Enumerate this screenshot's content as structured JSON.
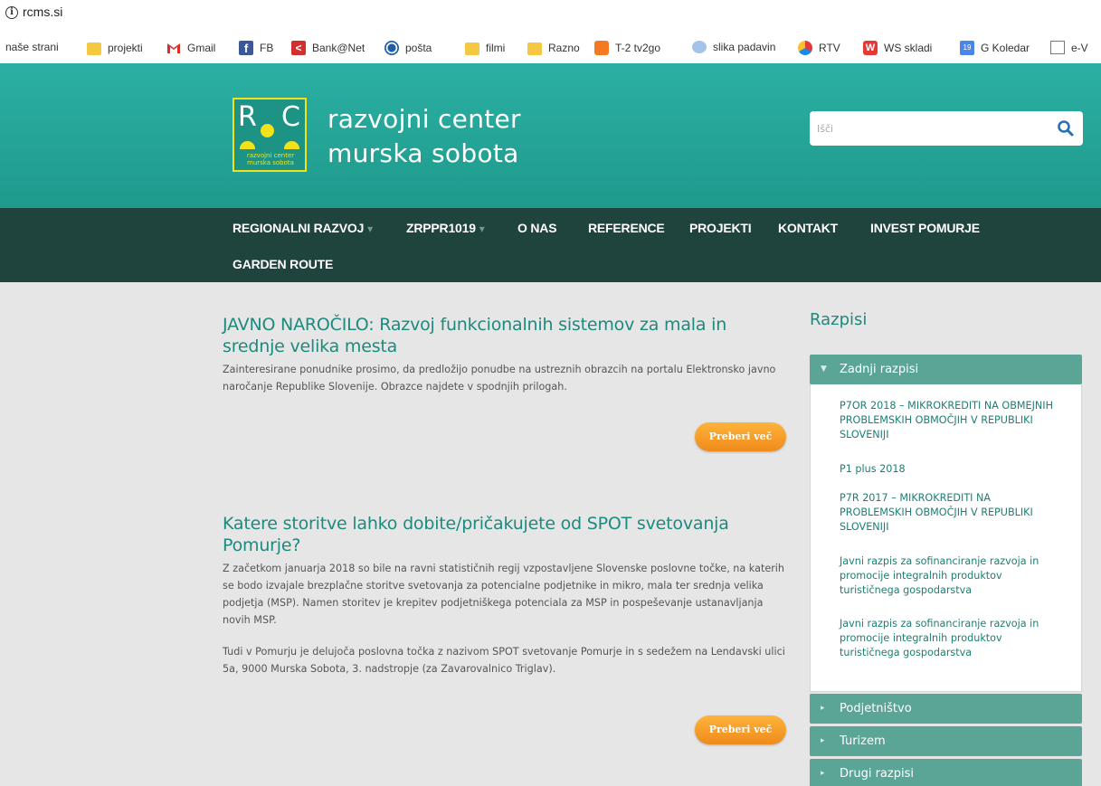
{
  "browser": {
    "url": "rcms.si",
    "bookmarks": [
      {
        "label": "naše strani",
        "icon": "none"
      },
      {
        "label": "projekti",
        "icon": "folder-icon"
      },
      {
        "label": "Gmail",
        "icon": "gmail-icon"
      },
      {
        "label": "FB",
        "icon": "facebook-icon"
      },
      {
        "label": "Bank@Net",
        "icon": "bank-icon"
      },
      {
        "label": "pošta",
        "icon": "posta-icon"
      },
      {
        "label": "filmi",
        "icon": "folder-icon"
      },
      {
        "label": "Razno",
        "icon": "folder-icon"
      },
      {
        "label": "T-2 tv2go",
        "icon": "t2-icon"
      },
      {
        "label": "slika padavin",
        "icon": "weather-icon"
      },
      {
        "label": "RTV",
        "icon": "rtv-icon"
      },
      {
        "label": "WS skladi",
        "icon": "ws-icon"
      },
      {
        "label": "G Koledar",
        "icon": "calendar-icon"
      },
      {
        "label": "e-V",
        "icon": "document-icon"
      }
    ]
  },
  "header": {
    "logo_letter_left": "R",
    "logo_letter_right": "C",
    "logo_small_line1": "razvojni center",
    "logo_small_line2": "murska sobota",
    "title_line1": "razvojni center",
    "title_line2": "murska sobota",
    "search_placeholder": "Išči",
    "colors": {
      "header_bg": "#21a596",
      "nav_bg": "#1f443d",
      "logo_yellow": "#f2e21a",
      "accent_orange": "#f5a02a"
    }
  },
  "nav": {
    "items": [
      {
        "label": "REGIONALNI RAZVOJ",
        "dropdown": true
      },
      {
        "label": "ZRPPR1019",
        "dropdown": true
      },
      {
        "label": "O NAS",
        "dropdown": false
      },
      {
        "label": "REFERENCE",
        "dropdown": false
      },
      {
        "label": "PROJEKTI",
        "dropdown": false
      },
      {
        "label": "KONTAKT",
        "dropdown": false
      },
      {
        "label": "INVEST POMURJE",
        "dropdown": false
      },
      {
        "label": "GARDEN ROUTE",
        "dropdown": false
      }
    ]
  },
  "articles": [
    {
      "title": "JAVNO NAROČILO: Razvoj funkcionalnih sistemov za mala in srednje velika mesta",
      "paragraphs": [
        "Zainteresirane ponudnike prosimo, da predložijo ponudbe na ustreznih obrazcih na portalu Elektronsko javno naročanje Republike Slovenije. Obrazce najdete v spodnjih prilogah."
      ],
      "button": "Preberi več"
    },
    {
      "title": "Katere storitve lahko dobite/pričakujete od SPOT svetovanja Pomurje?",
      "paragraphs": [
        "Z začetkom januarja 2018 so bile na ravni statističnih regij vzpostavljene Slovenske poslovne točke, na katerih se bodo izvajale brezplačne storitve svetovanja za potencialne podjetnike in mikro, mala ter srednja velika podjetja (MSP). Namen storitev je krepitev podjetniškega potenciala za MSP in pospeševanje ustanavljanja novih MSP.",
        "Tudi v Pomurju je delujoča poslovna točka z nazivom SPOT svetovanje Pomurje in s sedežem na Lendavski ulici 5a, 9000 Murska Sobota, 3. nadstropje (za Zavarovalnico Triglav)."
      ],
      "button": "Preberi več"
    }
  ],
  "sidebar": {
    "title": "Razpisi",
    "open_section": "Zadnji razpisi",
    "links": [
      "P7OR 2018 – MIKROKREDITI NA OBMEJNIH PROBLEMSKIH OBMOČJIH V REPUBLIKI SLOVENIJI",
      "P1 plus 2018",
      "P7R 2017 – MIKROKREDITI NA PROBLEMSKIH OBMOČJIH V REPUBLIKI SLOVENIJI",
      "Javni razpis za sofinanciranje razvoja in promocije integralnih produktov turističnega gospodarstva",
      "Javni razpis za sofinanciranje razvoja in promocije integralnih produktov turističnega gospodarstva"
    ],
    "collapsed_sections": [
      "Podjetništvo",
      "Turizem",
      "Drugi razpisi"
    ]
  }
}
